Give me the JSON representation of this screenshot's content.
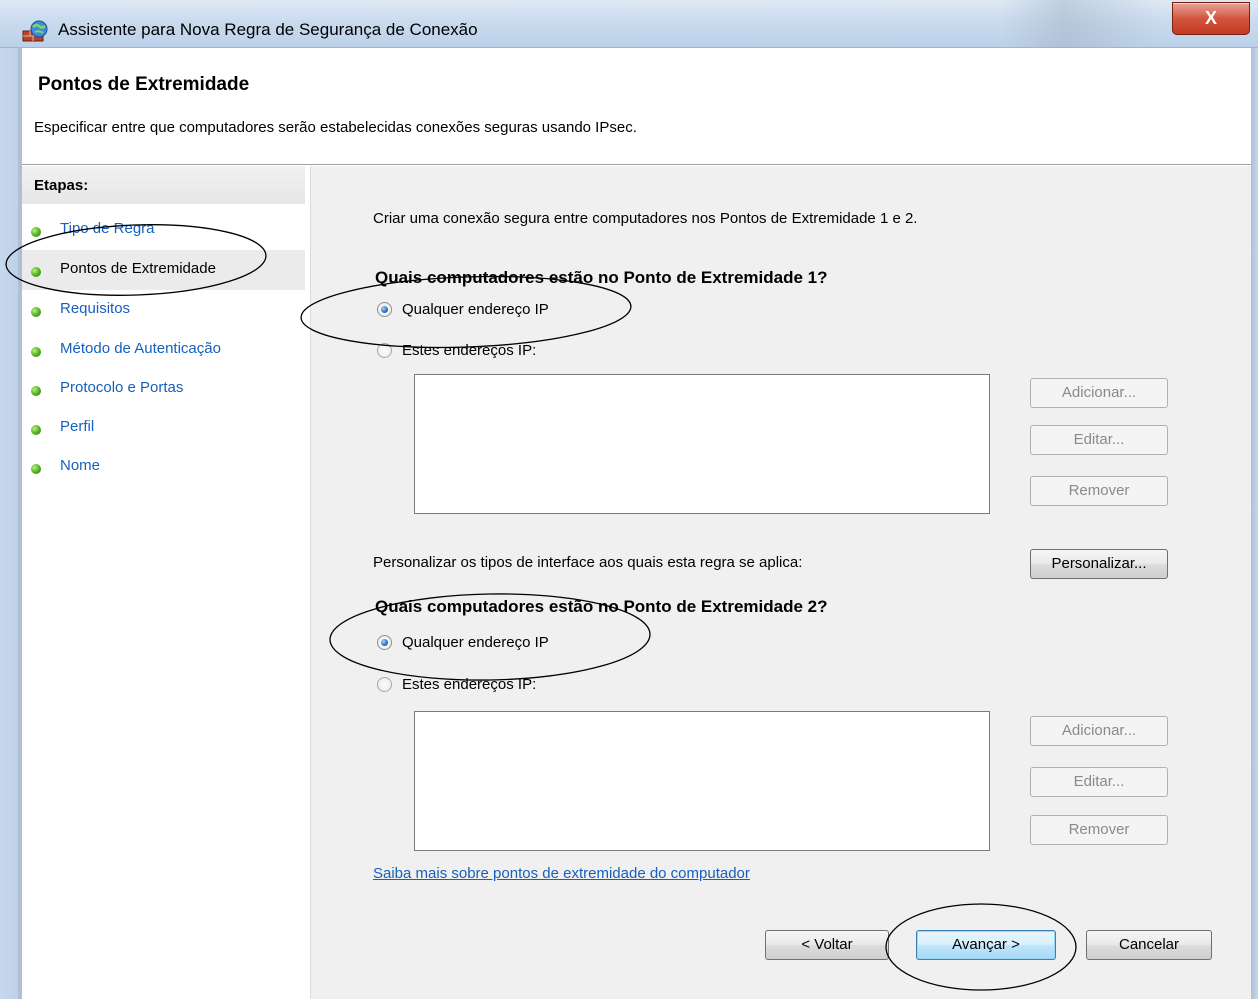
{
  "window": {
    "title": "Assistente para Nova Regra de Segurança de Conexão",
    "close_label": "X",
    "icon": "firewall-rule-icon"
  },
  "header": {
    "title": "Pontos de Extremidade",
    "description": "Especificar entre que computadores serão estabelecidas conexões seguras usando IPsec."
  },
  "sidebar": {
    "heading": "Etapas:",
    "items": [
      {
        "label": "Tipo de Regra",
        "current": false
      },
      {
        "label": "Pontos de Extremidade",
        "current": true
      },
      {
        "label": "Requisitos",
        "current": false
      },
      {
        "label": "Método de Autenticação",
        "current": false
      },
      {
        "label": "Protocolo e Portas",
        "current": false
      },
      {
        "label": "Perfil",
        "current": false
      },
      {
        "label": "Nome",
        "current": false
      }
    ]
  },
  "main": {
    "intro": "Criar uma conexão segura entre computadores nos Pontos de Extremidade 1 e 2.",
    "endpoint1": {
      "question": "Quais computadores estão no Ponto de Extremidade 1?",
      "option_any": "Qualquer endereço IP",
      "option_these": "Estes endereços IP:",
      "selected": "any",
      "add_label": "Adicionar...",
      "edit_label": "Editar...",
      "remove_label": "Remover"
    },
    "customize_text": "Personalizar os tipos de interface aos quais esta regra se aplica:",
    "customize_label": "Personalizar...",
    "endpoint2": {
      "question": "Quais computadores estão no Ponto de Extremidade 2?",
      "option_any": "Qualquer endereço IP",
      "option_these": "Estes endereços IP:",
      "selected": "any",
      "add_label": "Adicionar...",
      "edit_label": "Editar...",
      "remove_label": "Remover"
    },
    "learn_more_link": "Saiba mais sobre pontos de extremidade do computador"
  },
  "footer": {
    "back_label": "< Voltar",
    "next_label": "Avançar >",
    "cancel_label": "Cancelar"
  },
  "colors": {
    "link": "#1660bd",
    "step_dot": "#4cad1e",
    "panel_bg": "#f0f0f0",
    "close_button": "#c33b22"
  }
}
